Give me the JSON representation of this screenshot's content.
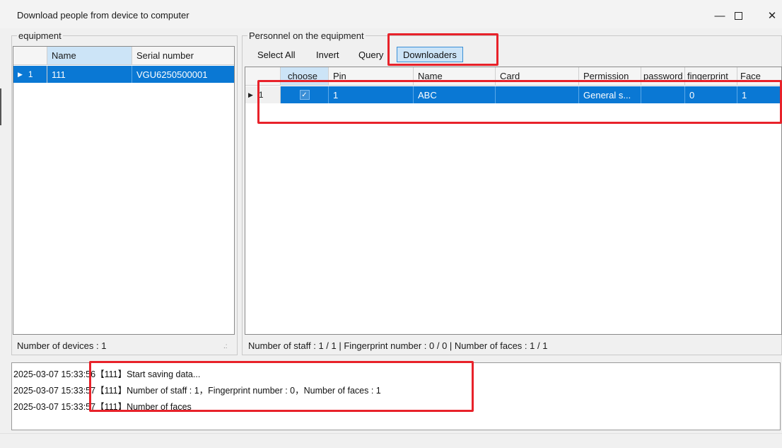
{
  "window": {
    "title": "Download people from device to computer",
    "minimize_glyph": "—",
    "close_glyph": "✕"
  },
  "equipment": {
    "group_label": "equipment",
    "columns": [
      "Name",
      "Serial number"
    ],
    "rows": [
      {
        "index": "1",
        "name": "111",
        "serial": "VGU6250500001"
      }
    ],
    "status": "Number of devices :  1"
  },
  "personnel": {
    "group_label": "Personnel on the equipment",
    "toolbar": {
      "select_all": "Select All",
      "invert": "Invert",
      "query": "Query",
      "downloaders": "Downloaders"
    },
    "columns": [
      "choose",
      "Pin",
      "Name",
      "Card",
      "Permission",
      "password",
      "fingerprint",
      "Face"
    ],
    "rows": [
      {
        "index": "1",
        "choose": true,
        "pin": "1",
        "name": "ABC",
        "card": "",
        "permission": "General s...",
        "password": "",
        "fingerprint": "0",
        "face": "1"
      }
    ],
    "status": "Number of staff :  1  /  1  |  Fingerprint number :  0  /  0  |  Number of faces :  1  /  1"
  },
  "log": {
    "lines": [
      "2025-03-07 15:33:56【111】Start saving data...",
      "2025-03-07 15:33:57【111】Number of staff : 1，Fingerprint number : 0，Number of faces : 1",
      "2025-03-07 15:33:57【111】Number of faces"
    ]
  },
  "icons": {
    "row_pointer": "row-pointer-icon",
    "check": "check-icon",
    "maximize": "maximize-icon",
    "minimize": "minimize-icon",
    "close": "close-icon"
  },
  "colors": {
    "selection": "#0a78d4",
    "header_selected": "#cce4f7",
    "annotation": "#e8222a"
  }
}
